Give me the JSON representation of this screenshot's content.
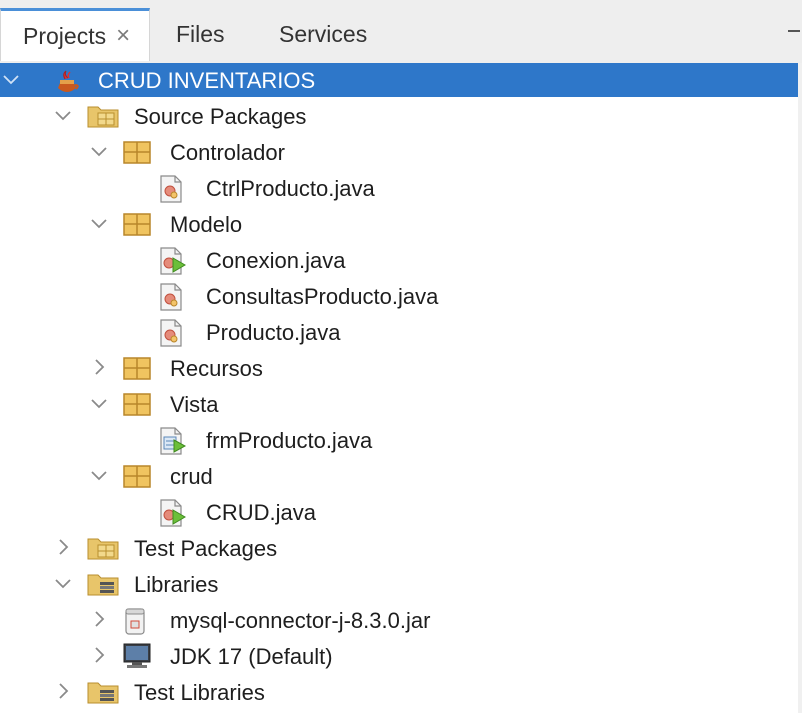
{
  "tabs": [
    {
      "label": "Projects",
      "close": "×"
    },
    {
      "label": "Files"
    },
    {
      "label": "Services"
    }
  ],
  "tree": [
    {
      "label": "CRUD INVENTARIOS",
      "icon": "java-project-icon",
      "expanded": true
    },
    {
      "label": "Source Packages",
      "icon": "source-packages-icon",
      "expanded": true
    },
    {
      "label": "Controlador",
      "icon": "package-icon",
      "expanded": true
    },
    {
      "label": "CtrlProducto.java",
      "icon": "java-class-icon"
    },
    {
      "label": "Modelo",
      "icon": "package-icon",
      "expanded": true
    },
    {
      "label": "Conexion.java",
      "icon": "java-main-class-icon"
    },
    {
      "label": "ConsultasProducto.java",
      "icon": "java-class-icon"
    },
    {
      "label": "Producto.java",
      "icon": "java-class-icon"
    },
    {
      "label": "Recursos",
      "icon": "package-icon",
      "expanded": false
    },
    {
      "label": "Vista",
      "icon": "package-icon",
      "expanded": true
    },
    {
      "label": "frmProducto.java",
      "icon": "java-form-icon"
    },
    {
      "label": "crud",
      "icon": "package-icon",
      "expanded": true
    },
    {
      "label": "CRUD.java",
      "icon": "java-main-class-icon"
    },
    {
      "label": "Test Packages",
      "icon": "test-packages-icon",
      "expanded": false
    },
    {
      "label": "Libraries",
      "icon": "libraries-icon",
      "expanded": true
    },
    {
      "label": "mysql-connector-j-8.3.0.jar",
      "icon": "jar-icon",
      "expanded": false
    },
    {
      "label": "JDK 17 (Default)",
      "icon": "jdk-icon",
      "expanded": false
    },
    {
      "label": "Test Libraries",
      "icon": "libraries-icon",
      "expanded": false
    }
  ],
  "colors": {
    "selection": "#2e77c9",
    "tab_accent": "#4a8fd8"
  }
}
